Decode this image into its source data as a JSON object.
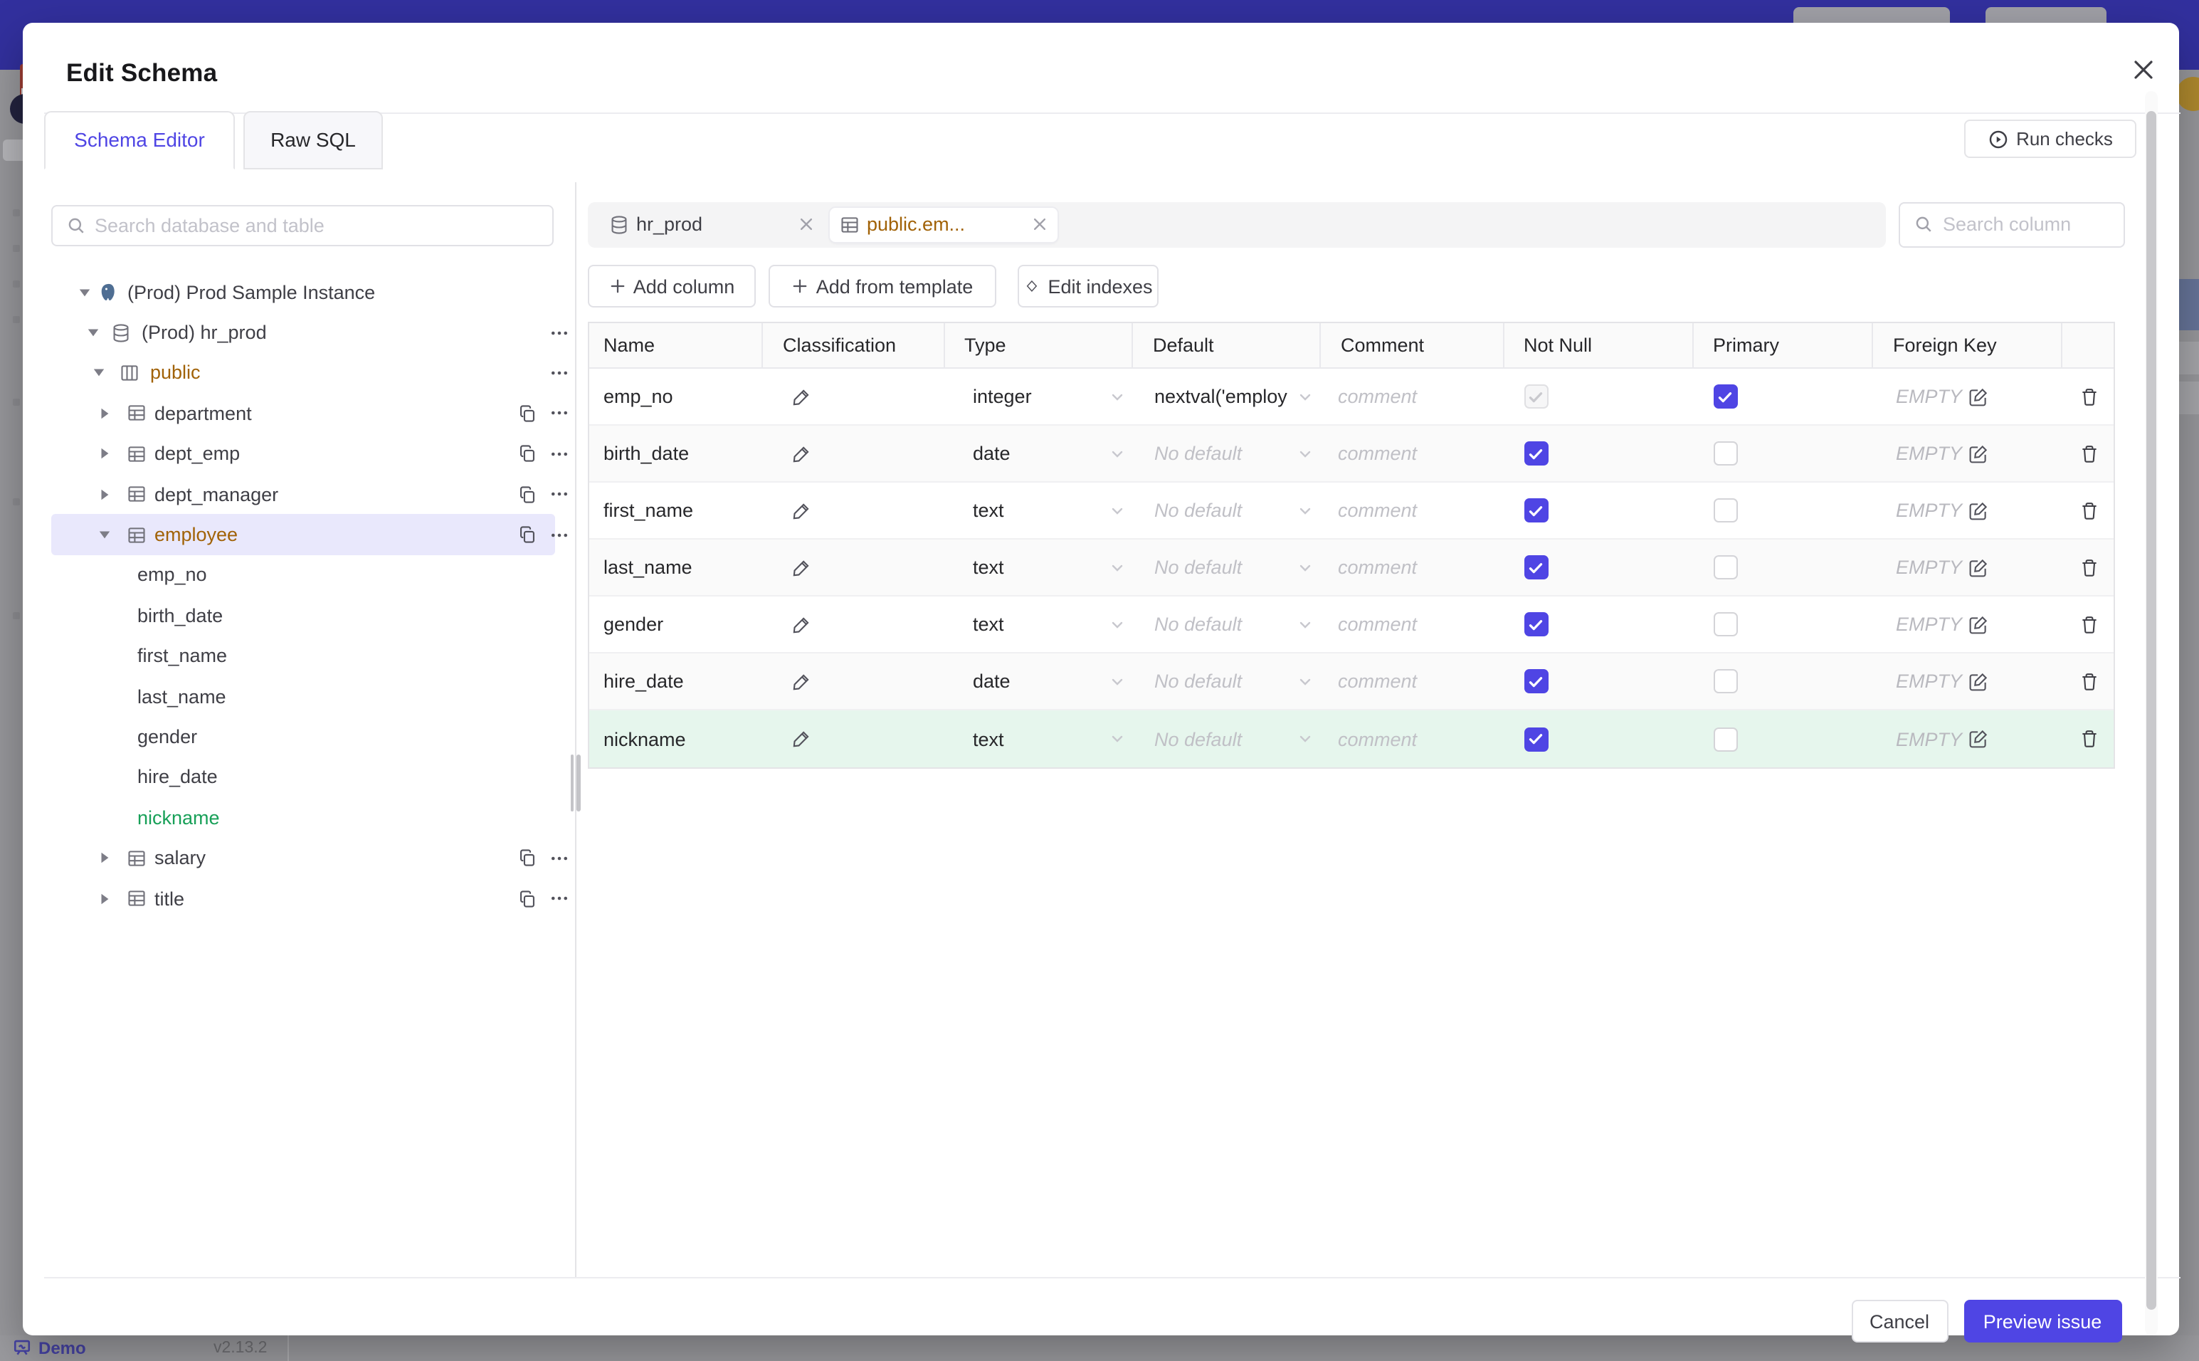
{
  "background": {
    "demo_label": "Demo",
    "version": "v2.13.2"
  },
  "modal": {
    "title": "Edit Schema",
    "run_checks_label": "Run checks",
    "tabs": [
      {
        "label": "Schema Editor",
        "active": true
      },
      {
        "label": "Raw SQL",
        "active": false
      }
    ],
    "footer": {
      "cancel_label": "Cancel",
      "preview_label": "Preview issue"
    }
  },
  "sidebar": {
    "search_placeholder": "Search database and table",
    "tree": [
      {
        "label": "(Prod) Prod Sample Instance",
        "icon": "postgres",
        "caret": "down",
        "level": 0
      },
      {
        "label": "(Prod) hr_prod",
        "icon": "database",
        "caret": "down",
        "level": 1,
        "more": true
      },
      {
        "label": "public",
        "icon": "schema",
        "caret": "down",
        "level": 2,
        "color": "modified",
        "more": true
      },
      {
        "label": "department",
        "icon": "table",
        "caret": "right",
        "level": 3,
        "copy": true,
        "more": true
      },
      {
        "label": "dept_emp",
        "icon": "table",
        "caret": "right",
        "level": 3,
        "copy": true,
        "more": true
      },
      {
        "label": "dept_manager",
        "icon": "table",
        "caret": "right",
        "level": 3,
        "copy": true,
        "more": true
      },
      {
        "label": "employee",
        "icon": "table",
        "caret": "down",
        "level": 3,
        "color": "modified",
        "copy": true,
        "more": true,
        "selected": true
      },
      {
        "label": "emp_no",
        "column": true
      },
      {
        "label": "birth_date",
        "column": true
      },
      {
        "label": "first_name",
        "column": true
      },
      {
        "label": "last_name",
        "column": true
      },
      {
        "label": "gender",
        "column": true
      },
      {
        "label": "hire_date",
        "column": true
      },
      {
        "label": "nickname",
        "column": true,
        "color": "created"
      },
      {
        "label": "salary",
        "icon": "table",
        "caret": "right",
        "level": 3,
        "copy": true,
        "more": true
      },
      {
        "label": "title",
        "icon": "table",
        "caret": "right",
        "level": 3,
        "copy": true,
        "more": true
      }
    ]
  },
  "editor": {
    "chips": [
      {
        "label": "hr_prod",
        "icon": "database",
        "active": false
      },
      {
        "label": "public.em...",
        "icon": "table",
        "active": true,
        "color": "modified"
      }
    ],
    "column_search_placeholder": "Search column",
    "toolbar": [
      {
        "label": "Add column",
        "icon": "plus",
        "width": 118
      },
      {
        "label": "Add from template",
        "icon": "plus",
        "width": 160,
        "gap": 9
      },
      {
        "label": "Edit indexes",
        "icon": "diamond",
        "width": 99,
        "gap": 15
      }
    ],
    "table": {
      "headers": [
        "Name",
        "Classification",
        "Type",
        "Default",
        "Comment",
        "Not Null",
        "Primary",
        "Foreign Key"
      ],
      "no_default_label": "No default",
      "comment_placeholder": "comment",
      "fk_placeholder": "EMPTY",
      "rows": [
        {
          "name": "emp_no",
          "type": "integer",
          "default": "nextval('employ",
          "has_default": true,
          "not_null": true,
          "not_null_disabled": true,
          "primary": true
        },
        {
          "name": "birth_date",
          "type": "date",
          "not_null": true,
          "primary": false
        },
        {
          "name": "first_name",
          "type": "text",
          "not_null": true,
          "primary": false
        },
        {
          "name": "last_name",
          "type": "text",
          "not_null": true,
          "primary": false
        },
        {
          "name": "gender",
          "type": "text",
          "not_null": true,
          "primary": false
        },
        {
          "name": "hire_date",
          "type": "date",
          "not_null": true,
          "primary": false
        },
        {
          "name": "nickname",
          "type": "text",
          "not_null": true,
          "primary": false,
          "highlight": "created"
        }
      ]
    }
  },
  "colors": {
    "accent": "#4f45e4",
    "modified": "#a16207",
    "created": "#18a058",
    "created_row_bg": "#e6f6ed",
    "selected_tree_bg": "#e9e8fc",
    "navbar_dimmed": "#32309e"
  }
}
